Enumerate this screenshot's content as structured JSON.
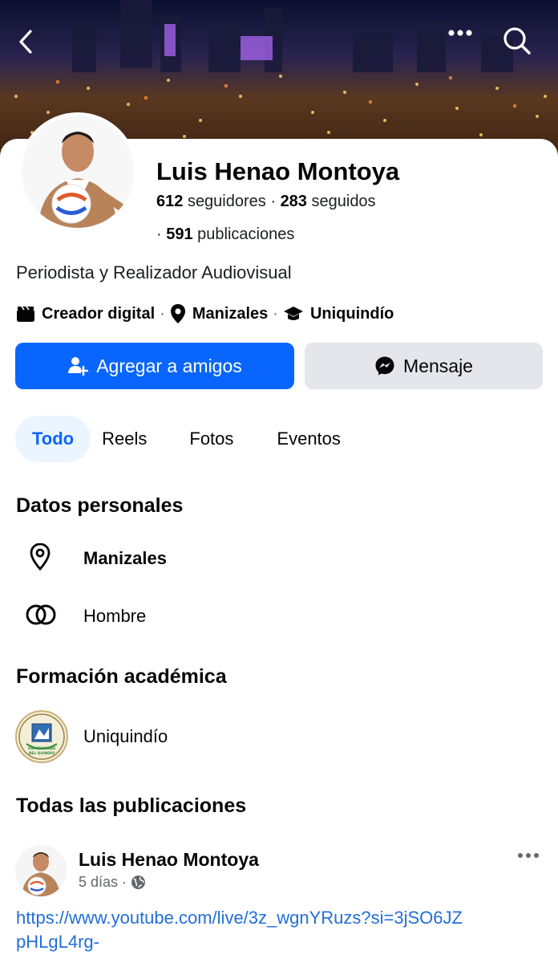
{
  "header": {
    "back_icon": "chevron-left-icon",
    "more_icon": "more-horizontal-icon",
    "search_icon": "search-icon"
  },
  "profile": {
    "name": "Luis Henao Montoya",
    "followers_count": "612",
    "followers_label": "seguidores",
    "following_count": "283",
    "following_label": "seguidos",
    "posts_count": "591",
    "posts_label": "publicaciones",
    "bio": "Periodista y Realizador Audiovisual",
    "meta": {
      "category": "Creador digital",
      "location": "Manizales",
      "education": "Uniquindío"
    }
  },
  "actions": {
    "add_friend": "Agregar a amigos",
    "message": "Mensaje"
  },
  "tabs": [
    {
      "label": "Todo",
      "active": true
    },
    {
      "label": "Reels",
      "active": false
    },
    {
      "label": "Fotos",
      "active": false
    },
    {
      "label": "Eventos",
      "active": false
    }
  ],
  "personal": {
    "title": "Datos personales",
    "location": "Manizales",
    "gender": "Hombre"
  },
  "education": {
    "title": "Formación académica",
    "school": "Uniquindío",
    "logo_text": "UNIVERSIDAD DEL QUINDÍO"
  },
  "posts": {
    "title": "Todas las publicaciones",
    "items": [
      {
        "author": "Luis Henao Montoya",
        "time": "5 días",
        "privacy_icon": "globe-icon",
        "text": "https://www.youtube.com/live/3z_wgnYRuzs?si=3jSO6JZpHLgL4rg-"
      }
    ]
  },
  "colors": {
    "accent": "#0866ff",
    "tab_active_bg": "#ebf5ff",
    "secondary_button": "#e4e6eb",
    "link": "#216fdb",
    "muted_text": "#65676b"
  }
}
